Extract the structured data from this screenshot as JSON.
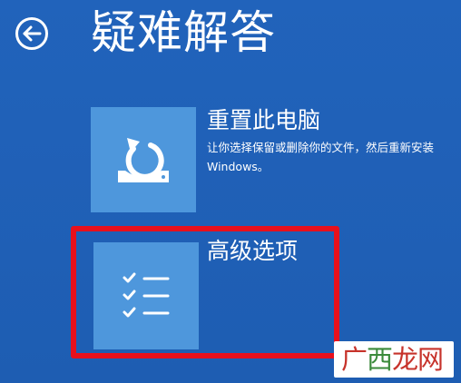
{
  "header": {
    "title": "疑难解答",
    "back_icon": "back-arrow-icon"
  },
  "options": [
    {
      "title": "重置此电脑",
      "description": "让你选择保留或删除你的文件，然后重新安装 Windows。",
      "icon": "reset-pc-icon"
    },
    {
      "title": "高级选项",
      "description": "",
      "icon": "checklist-icon"
    }
  ],
  "watermark": {
    "text_a": "广",
    "text_b": "西",
    "text_c": "龙网"
  },
  "colors": {
    "background": "#1f5fb5",
    "tile": "#4e97dc",
    "highlight": "#e8101c",
    "text": "#ffffff"
  }
}
